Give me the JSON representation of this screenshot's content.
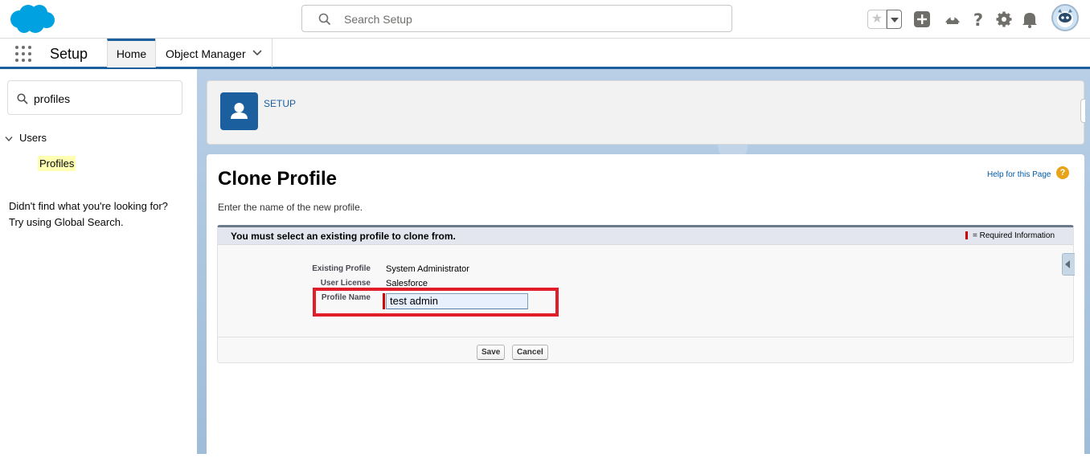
{
  "header": {
    "search_placeholder": "Search Setup",
    "icons": [
      "salesforce-logo",
      "search-icon",
      "favorites-star-icon",
      "favorites-dropdown-icon",
      "global-actions-icon",
      "trailhead-icon",
      "help-icon",
      "gear-icon",
      "notifications-bell-icon",
      "user-avatar"
    ],
    "brand_color": "#00a1e0"
  },
  "context_bar": {
    "app_name": "Setup",
    "tabs": [
      {
        "label": "Home",
        "active": true
      },
      {
        "label": "Object Manager",
        "active": false
      }
    ]
  },
  "sidebar": {
    "quick_find_value": "profiles",
    "tree": {
      "section": "Users",
      "item": "Profiles"
    },
    "hint_line1": "Didn't find what you're looking for?",
    "hint_line2": "Try using Global Search."
  },
  "page_header": {
    "label": "SETUP"
  },
  "content": {
    "title": "Clone Profile",
    "help_link": "Help for this Page",
    "description": "Enter the name of the new profile.",
    "block_title": "You must select an existing profile to clone from.",
    "required_legend": "= Required Information",
    "fields": {
      "existing_profile_label": "Existing Profile",
      "existing_profile_value": "System Administrator",
      "user_license_label": "User License",
      "user_license_value": "Salesforce",
      "profile_name_label": "Profile Name",
      "profile_name_value": "test admin"
    },
    "buttons": {
      "save": "Save",
      "cancel": "Cancel"
    },
    "highlight_color": "#e01d28"
  }
}
